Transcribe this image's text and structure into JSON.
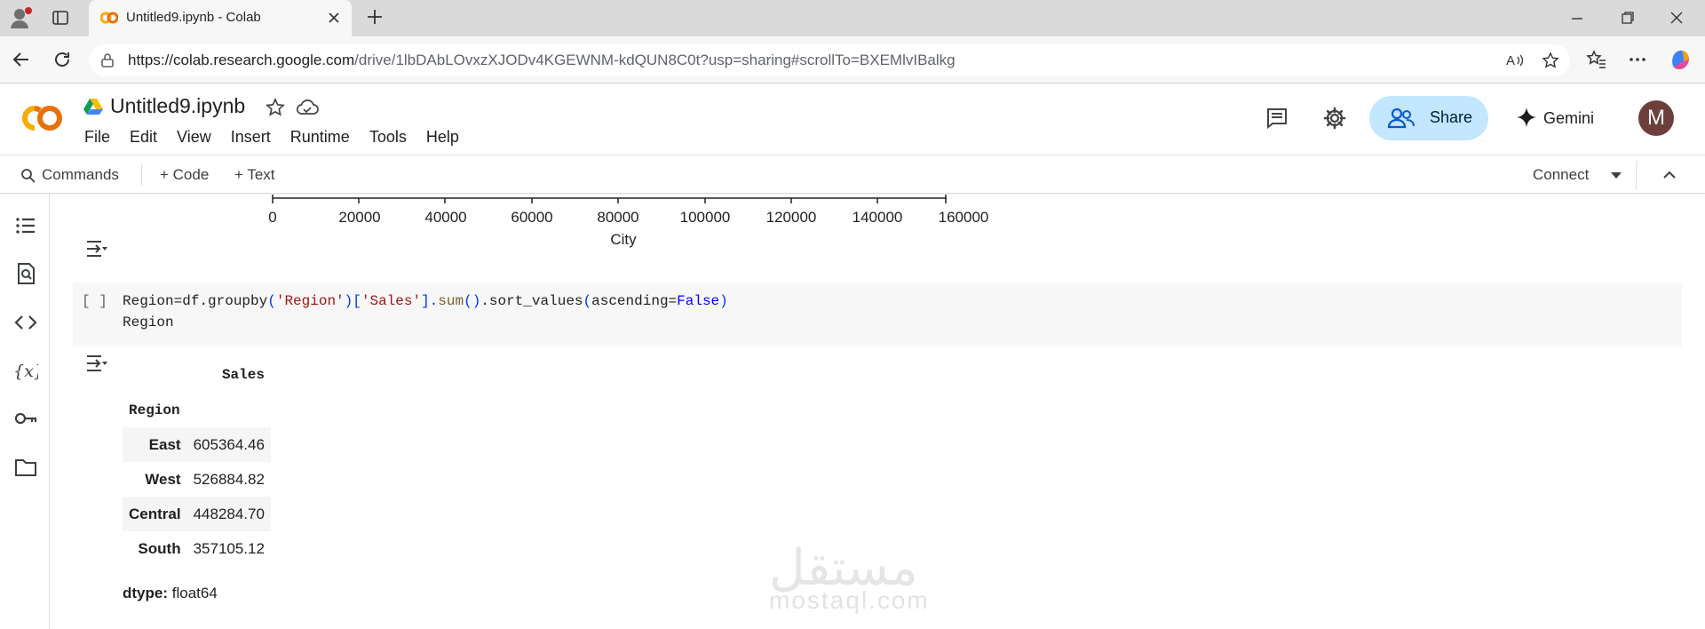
{
  "browser": {
    "tab_title": "Untitled9.ipynb - Colab",
    "url_host": "https://colab.research.google.com",
    "url_path": "/drive/1lbDAbLOvxzXJODv4KGEWNM-kdQUN8C0t?usp=sharing#scrollTo=BXEMlvIBalkg"
  },
  "colab": {
    "notebook_title": "Untitled9.ipynb",
    "menu": [
      "File",
      "Edit",
      "View",
      "Insert",
      "Runtime",
      "Tools",
      "Help"
    ],
    "share_label": "Share",
    "gemini_label": "Gemini",
    "avatar_letter": "M"
  },
  "toolbar": {
    "commands_label": "Commands",
    "add_code_label": "+ Code",
    "add_text_label": "+ Text",
    "connect_label": "Connect"
  },
  "plot_fragment": {
    "x_ticks": [
      "0",
      "20000",
      "40000",
      "60000",
      "80000",
      "100000",
      "120000",
      "140000",
      "160000"
    ],
    "x_label": "City"
  },
  "code_cell": {
    "exec_count": "[ ]",
    "line1_a": "Region=df.groupby",
    "line1_b": "(",
    "line1_c": "'Region'",
    "line1_d": ")[",
    "line1_e": "'Sales'",
    "line1_f": "].",
    "line1_g": "sum",
    "line1_h": "()",
    "line1_i": ".sort_values",
    "line1_j": "(",
    "line1_k": "ascending=",
    "line1_l": "False",
    "line1_m": ")",
    "line2": "Region"
  },
  "output_table": {
    "value_header": "Sales",
    "index_header": "Region",
    "rows": [
      {
        "region": "East",
        "sales": "605364.46"
      },
      {
        "region": "West",
        "sales": "526884.82"
      },
      {
        "region": "Central",
        "sales": "448284.70"
      },
      {
        "region": "South",
        "sales": "357105.12"
      }
    ],
    "dtype_label": "dtype:",
    "dtype_value": "float64"
  },
  "watermark": {
    "arabic": "مستقل",
    "latin": "mostaql.com"
  },
  "colors": {
    "colab_orange": "#f9ab00",
    "share_bg": "#c2e7ff",
    "avatar_bg": "#6d3f3a"
  }
}
